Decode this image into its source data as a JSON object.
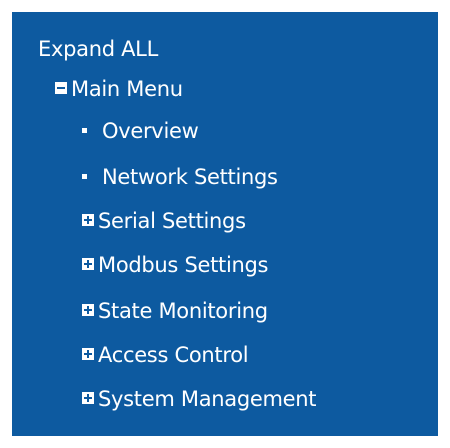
{
  "colors": {
    "panel_background": "#0d5aa0",
    "text": "#ffffff"
  },
  "menu": {
    "expand_all_label": "Expand ALL",
    "root": {
      "label": "Main Menu",
      "state": "expanded",
      "icon": "minus-box-icon"
    },
    "items": [
      {
        "label": "Overview",
        "type": "leaf",
        "icon": "bullet-icon"
      },
      {
        "label": "Network Settings",
        "type": "leaf",
        "icon": "bullet-icon"
      },
      {
        "label": "Serial Settings",
        "type": "folder",
        "state": "collapsed",
        "icon": "plus-box-icon"
      },
      {
        "label": "Modbus Settings",
        "type": "folder",
        "state": "collapsed",
        "icon": "plus-box-icon"
      },
      {
        "label": "State Monitoring",
        "type": "folder",
        "state": "collapsed",
        "icon": "plus-box-icon"
      },
      {
        "label": "Access Control",
        "type": "folder",
        "state": "collapsed",
        "icon": "plus-box-icon"
      },
      {
        "label": "System Management",
        "type": "folder",
        "state": "collapsed",
        "icon": "plus-box-icon"
      }
    ]
  }
}
